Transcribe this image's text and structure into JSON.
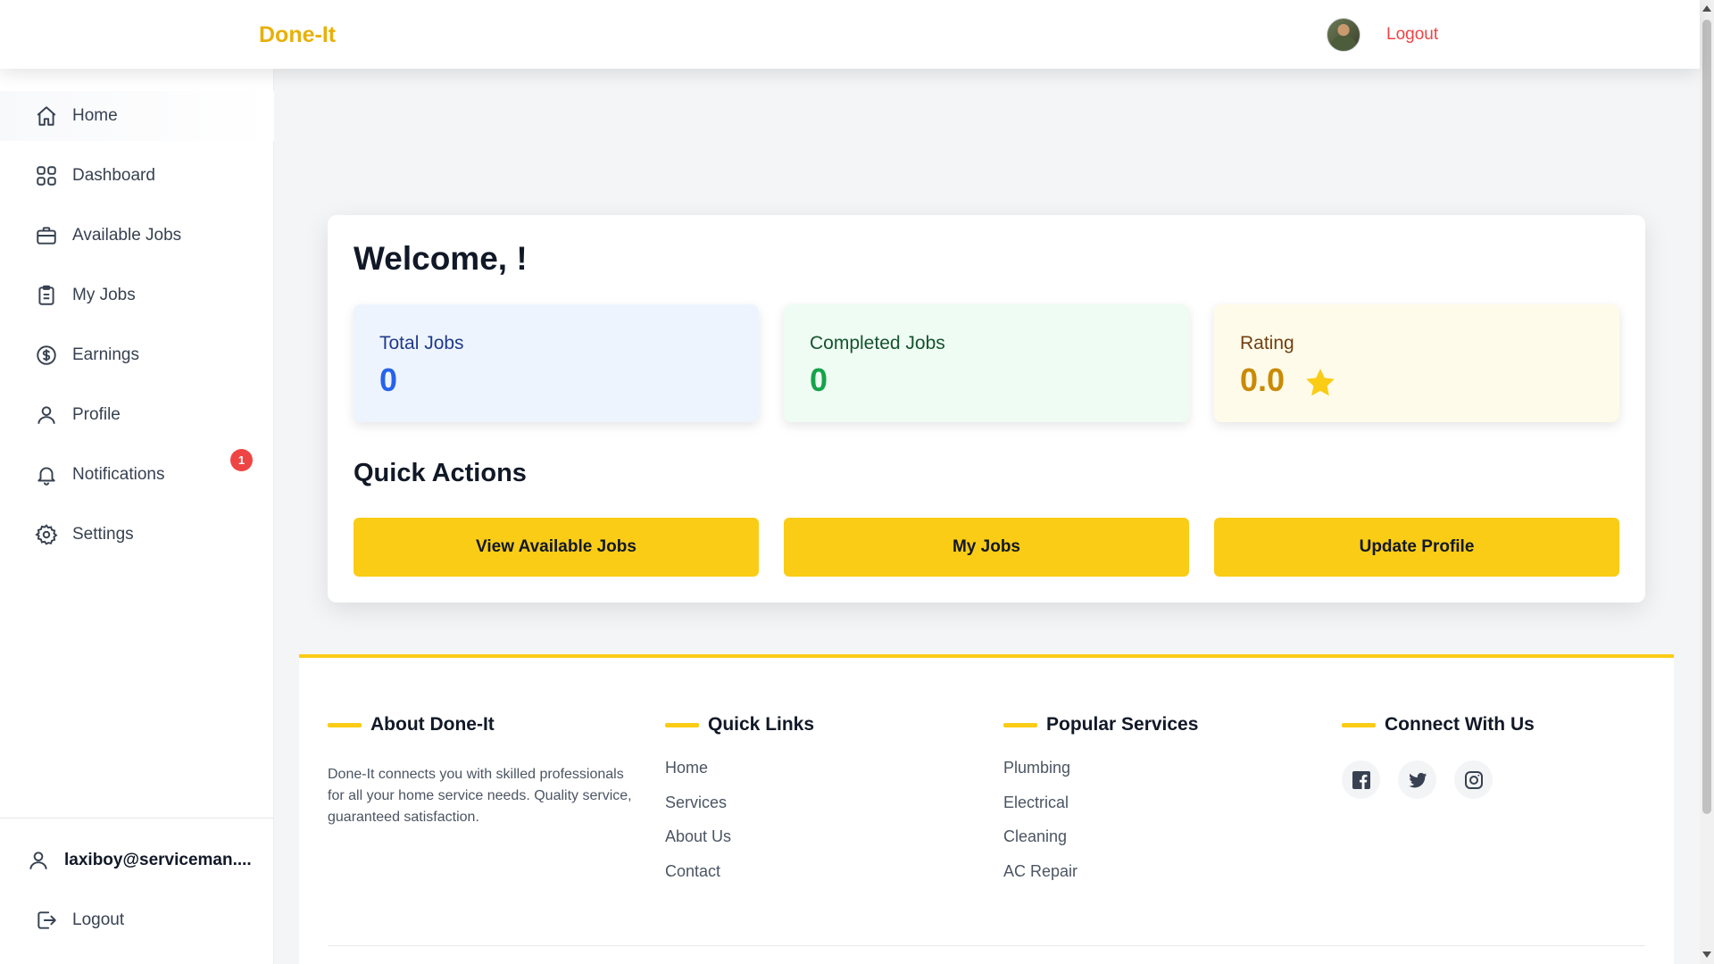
{
  "app": {
    "brand": "Done-It"
  },
  "header": {
    "logout_label": "Logout"
  },
  "sidebar": {
    "items": [
      {
        "label": "Home",
        "icon": "home-icon"
      },
      {
        "label": "Dashboard",
        "icon": "grid-icon"
      },
      {
        "label": "Available Jobs",
        "icon": "briefcase-icon"
      },
      {
        "label": "My Jobs",
        "icon": "clipboard-icon"
      },
      {
        "label": "Earnings",
        "icon": "dollar-icon"
      },
      {
        "label": "Profile",
        "icon": "user-icon"
      },
      {
        "label": "Notifications",
        "icon": "bell-icon",
        "badge": "1"
      },
      {
        "label": "Settings",
        "icon": "gear-icon"
      }
    ],
    "user_email": "laxiboy@serviceman....",
    "logout_label": "Logout"
  },
  "dashboard": {
    "welcome": "Welcome, !",
    "stats": [
      {
        "title": "Total Jobs",
        "value": "0",
        "color": "#2563eb"
      },
      {
        "title": "Completed Jobs",
        "value": "0",
        "color": "#16a34a"
      },
      {
        "title": "Rating",
        "value": "0.0",
        "color": "#ca8a04"
      }
    ],
    "quick_actions_title": "Quick Actions",
    "quick_actions": [
      {
        "label": "View Available Jobs"
      },
      {
        "label": "My Jobs"
      },
      {
        "label": "Update Profile"
      }
    ]
  },
  "footer": {
    "about": {
      "title": "About Done-It",
      "text": "Done-It connects you with skilled professionals for all your home service needs. Quality service, guaranteed satisfaction."
    },
    "quick_links": {
      "title": "Quick Links",
      "items": [
        "Home",
        "Services",
        "About Us",
        "Contact"
      ]
    },
    "popular_services": {
      "title": "Popular Services",
      "items": [
        "Plumbing",
        "Electrical",
        "Cleaning",
        "AC Repair"
      ]
    },
    "connect": {
      "title": "Connect With Us",
      "icons": [
        "facebook-icon",
        "twitter-icon",
        "instagram-icon"
      ]
    }
  },
  "colors": {
    "accent": "#facc15",
    "brand": "#e8b007",
    "danger": "#ef4444"
  }
}
